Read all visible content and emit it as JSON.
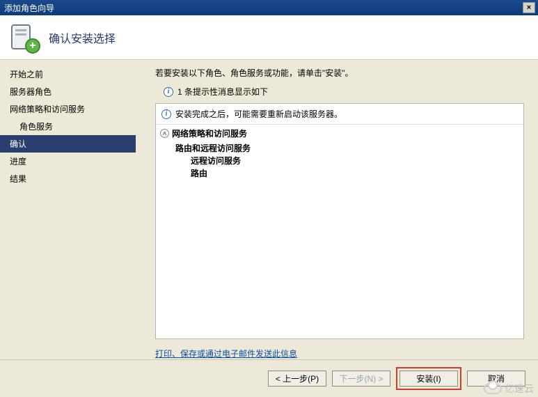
{
  "window": {
    "title": "添加角色向导",
    "close": "×"
  },
  "header": {
    "title": "确认安装选择",
    "plus": "+"
  },
  "sidebar": {
    "items": [
      {
        "label": "开始之前",
        "indent": false,
        "active": false
      },
      {
        "label": "服务器角色",
        "indent": false,
        "active": false
      },
      {
        "label": "网络策略和访问服务",
        "indent": false,
        "active": false
      },
      {
        "label": "角色服务",
        "indent": true,
        "active": false
      },
      {
        "label": "确认",
        "indent": false,
        "active": true
      },
      {
        "label": "进度",
        "indent": false,
        "active": false
      },
      {
        "label": "结果",
        "indent": false,
        "active": false
      }
    ]
  },
  "content": {
    "instruction": "若要安装以下角色、角色服务或功能，请单击\"安装\"。",
    "info_count_line": "1 条提示性消息显示如下",
    "panel_info": "安装完成之后，可能需要重新启动该服务器。",
    "group_title": "网络策略和访问服务",
    "rows": {
      "r1": "路由和远程访问服务",
      "r2": "远程访问服务",
      "r3": "路由"
    },
    "link_text": "打印、保存或通过电子邮件发送此信息"
  },
  "buttons": {
    "prev": "< 上一步(P)",
    "next": "下一步(N) >",
    "install": "安装(I)",
    "cancel": "取消"
  },
  "watermark": "亿速云"
}
